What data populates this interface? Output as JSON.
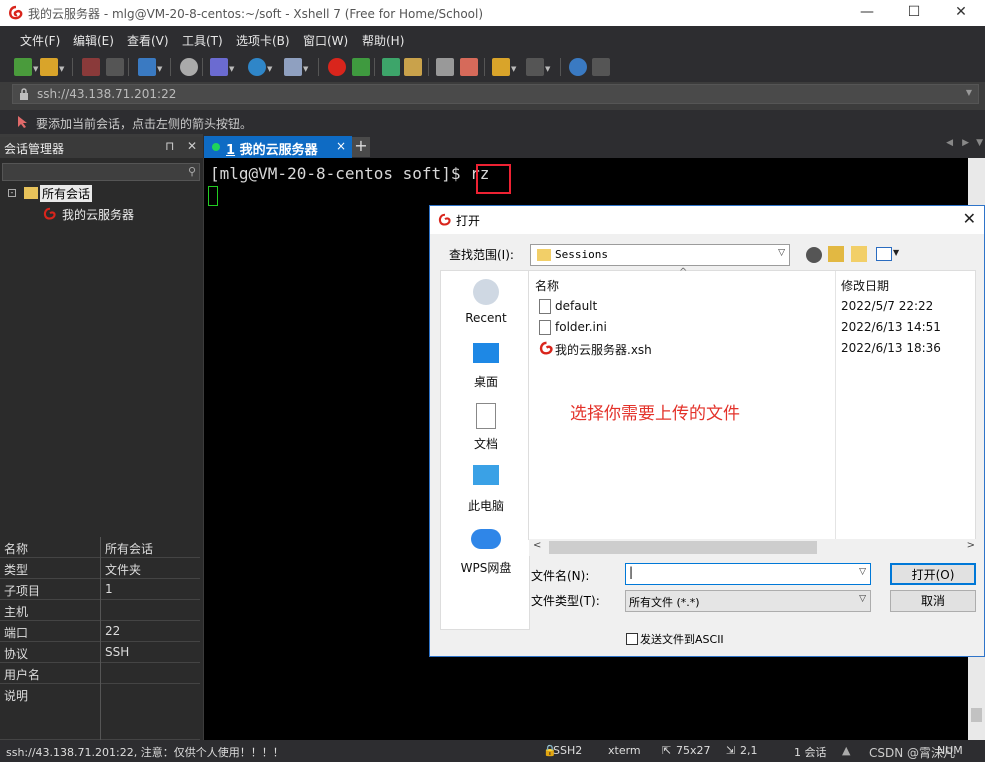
{
  "window": {
    "title": "我的云服务器 - mlg@VM-20-8-centos:~/soft - Xshell 7 (Free for Home/School)",
    "controls": {
      "minimize": "—",
      "maximize": "☐",
      "close": "✕"
    }
  },
  "menu": [
    "文件(F)",
    "编辑(E)",
    "查看(V)",
    "工具(T)",
    "选项卡(B)",
    "窗口(W)",
    "帮助(H)"
  ],
  "address": {
    "value": "ssh://43.138.71.201:22"
  },
  "hint": "要添加当前会话，点击左侧的箭头按钮。",
  "session_manager": {
    "title": "会话管理器",
    "tree": {
      "root": "所有会话",
      "child": "我的云服务器"
    },
    "properties": [
      {
        "key": "名称",
        "value": "所有会话"
      },
      {
        "key": "类型",
        "value": "文件夹"
      },
      {
        "key": "子项目",
        "value": "1"
      },
      {
        "key": "主机",
        "value": ""
      },
      {
        "key": "端口",
        "value": "22"
      },
      {
        "key": "协议",
        "value": "SSH"
      },
      {
        "key": "用户名",
        "value": ""
      },
      {
        "key": "说明",
        "value": ""
      }
    ]
  },
  "tab": {
    "num": "1",
    "label": "我的云服务器",
    "close": "×"
  },
  "terminal": {
    "prompt": "[mlg@VM-20-8-centos soft]$ ",
    "command": "rz"
  },
  "status": {
    "left": "ssh://43.138.71.201:22, 注意：仅供个人使用！！！！",
    "protocol": "SSH2",
    "term": "xterm",
    "size": "75x27",
    "pos": "2,1",
    "sessions": "1 会话",
    "watermark": "CSDN @霄沫凡",
    "num": "NUM"
  },
  "dialog": {
    "title": "打开",
    "lookin_label": "查找范围(I):",
    "lookin_value": "Sessions",
    "places": [
      "Recent",
      "桌面",
      "文档",
      "此电脑",
      "WPS网盘"
    ],
    "columns": {
      "name": "名称",
      "modified": "修改日期"
    },
    "files": [
      {
        "name": "default",
        "date": "2022/5/7 22:22"
      },
      {
        "name": "folder.ini",
        "date": "2022/6/13 14:51"
      },
      {
        "name": "我的云服务器.xsh",
        "date": "2022/6/13 18:36"
      }
    ],
    "filename_label": "文件名(N):",
    "filename_value": "",
    "filetype_label": "文件类型(T):",
    "filetype_value": "所有文件 (*.*)",
    "open_button": "打开(O)",
    "cancel_button": "取消",
    "ascii_checkbox": "发送文件到ASCII"
  },
  "annotation": "选择你需要上传的文件",
  "colors": {
    "accent": "#0e6bc4",
    "annotation": "#e3322a",
    "terminal_bg": "#000000"
  }
}
